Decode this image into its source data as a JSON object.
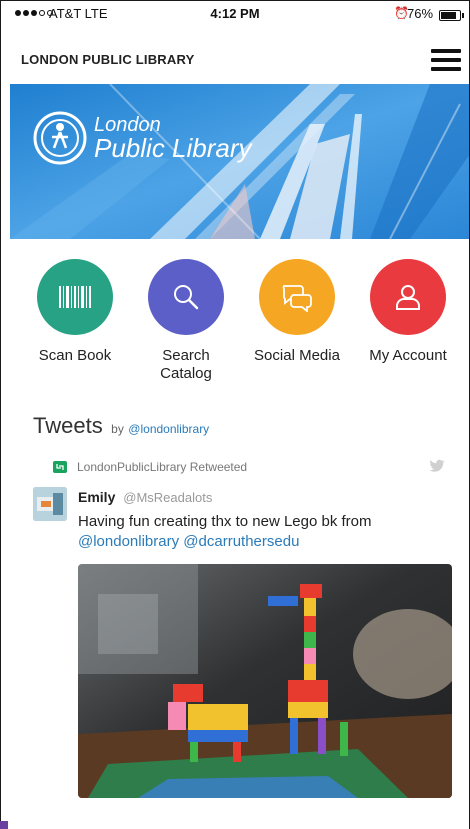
{
  "status_bar": {
    "carrier": "AT&T  LTE",
    "time": "4:12 PM",
    "battery": "76%",
    "battery_level": 0.76,
    "signal_bars": 3
  },
  "header": {
    "title": "LONDON PUBLIC LIBRARY",
    "menu_icon": "hamburger-icon"
  },
  "banner": {
    "logo_line1": "London",
    "logo_line2": "Public Library",
    "background_color": "#3a8fd6"
  },
  "actions": [
    {
      "label": "Scan Book",
      "icon": "barcode-icon",
      "color": "#27a284"
    },
    {
      "label": "Search Catalog",
      "icon": "search-icon",
      "color": "#5b5fc7"
    },
    {
      "label": "Social Media",
      "icon": "chat-bubbles-icon",
      "color": "#f5a623"
    },
    {
      "label": "My Account",
      "icon": "user-icon",
      "color": "#e83a3f"
    }
  ],
  "tweets": {
    "title": "Tweets",
    "by": "by",
    "handle": "@londonlibrary",
    "retweeted_text": "LondonPublicLibrary Retweeted",
    "author_name": "Emily",
    "author_handle": "@MsReadalots",
    "text": "Having fun creating thx to new Lego bk from",
    "mentions": [
      "@londonlibrary",
      "@dcarruthersedu"
    ]
  }
}
